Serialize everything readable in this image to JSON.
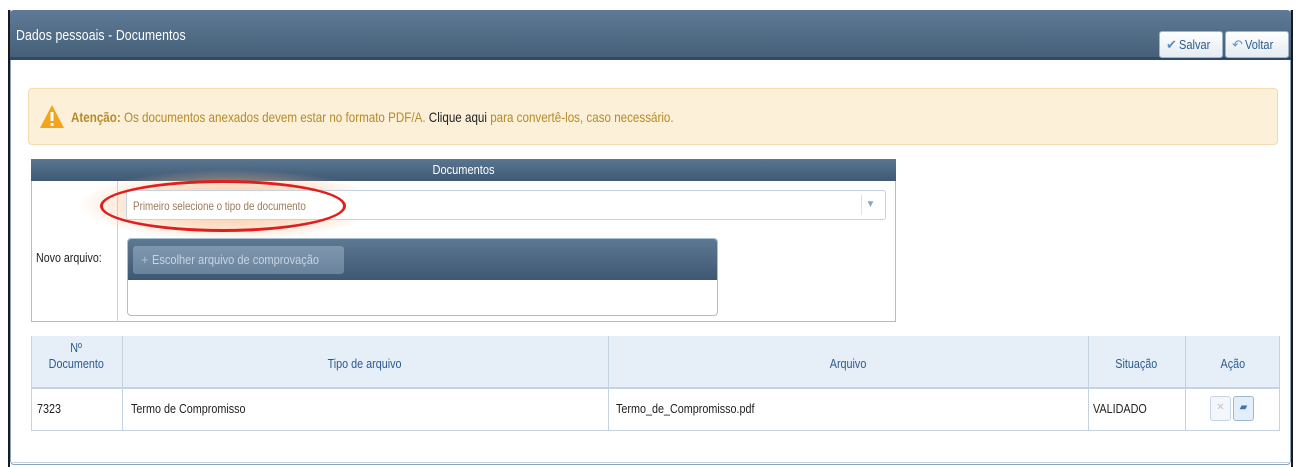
{
  "header": {
    "title": "Dados pessoais - Documentos",
    "save_label": "Salvar",
    "back_label": "Voltar"
  },
  "alert": {
    "prefix": "Atenção:",
    "message": "Os documentos anexados devem estar no formato PDF/A.",
    "link": "Clique aqui",
    "suffix": "para convertê-los, caso necessário."
  },
  "documents": {
    "header": "Documentos",
    "type_select": {
      "placeholder": "Primeiro selecione o tipo de documento"
    },
    "new_file_label": "Novo arquivo:",
    "choose_file_label": "Escolher arquivo de comprovação"
  },
  "table": {
    "columns": {
      "number_line1": "Nº",
      "number_line2": "Documento",
      "type": "Tipo de arquivo",
      "file": "Arquivo",
      "status": "Situação",
      "action": "Ação"
    },
    "rows": [
      {
        "number": "7323",
        "type": "Termo de Compromisso",
        "file": "Termo_de_Compromisso.pdf",
        "status": "VALIDADO"
      }
    ]
  },
  "icons": {
    "save": "check-icon",
    "back": "undo-arrow-icon",
    "alert": "warning-triangle-icon",
    "select": "chevron-down-icon",
    "add": "plus-icon",
    "delete": "close-icon",
    "open": "folder-open-icon"
  },
  "colors": {
    "header_bg": "#466078",
    "alert_bg": "#fcf0d9",
    "alert_text": "#b78a2a",
    "highlight_ring": "#e11e1e"
  }
}
